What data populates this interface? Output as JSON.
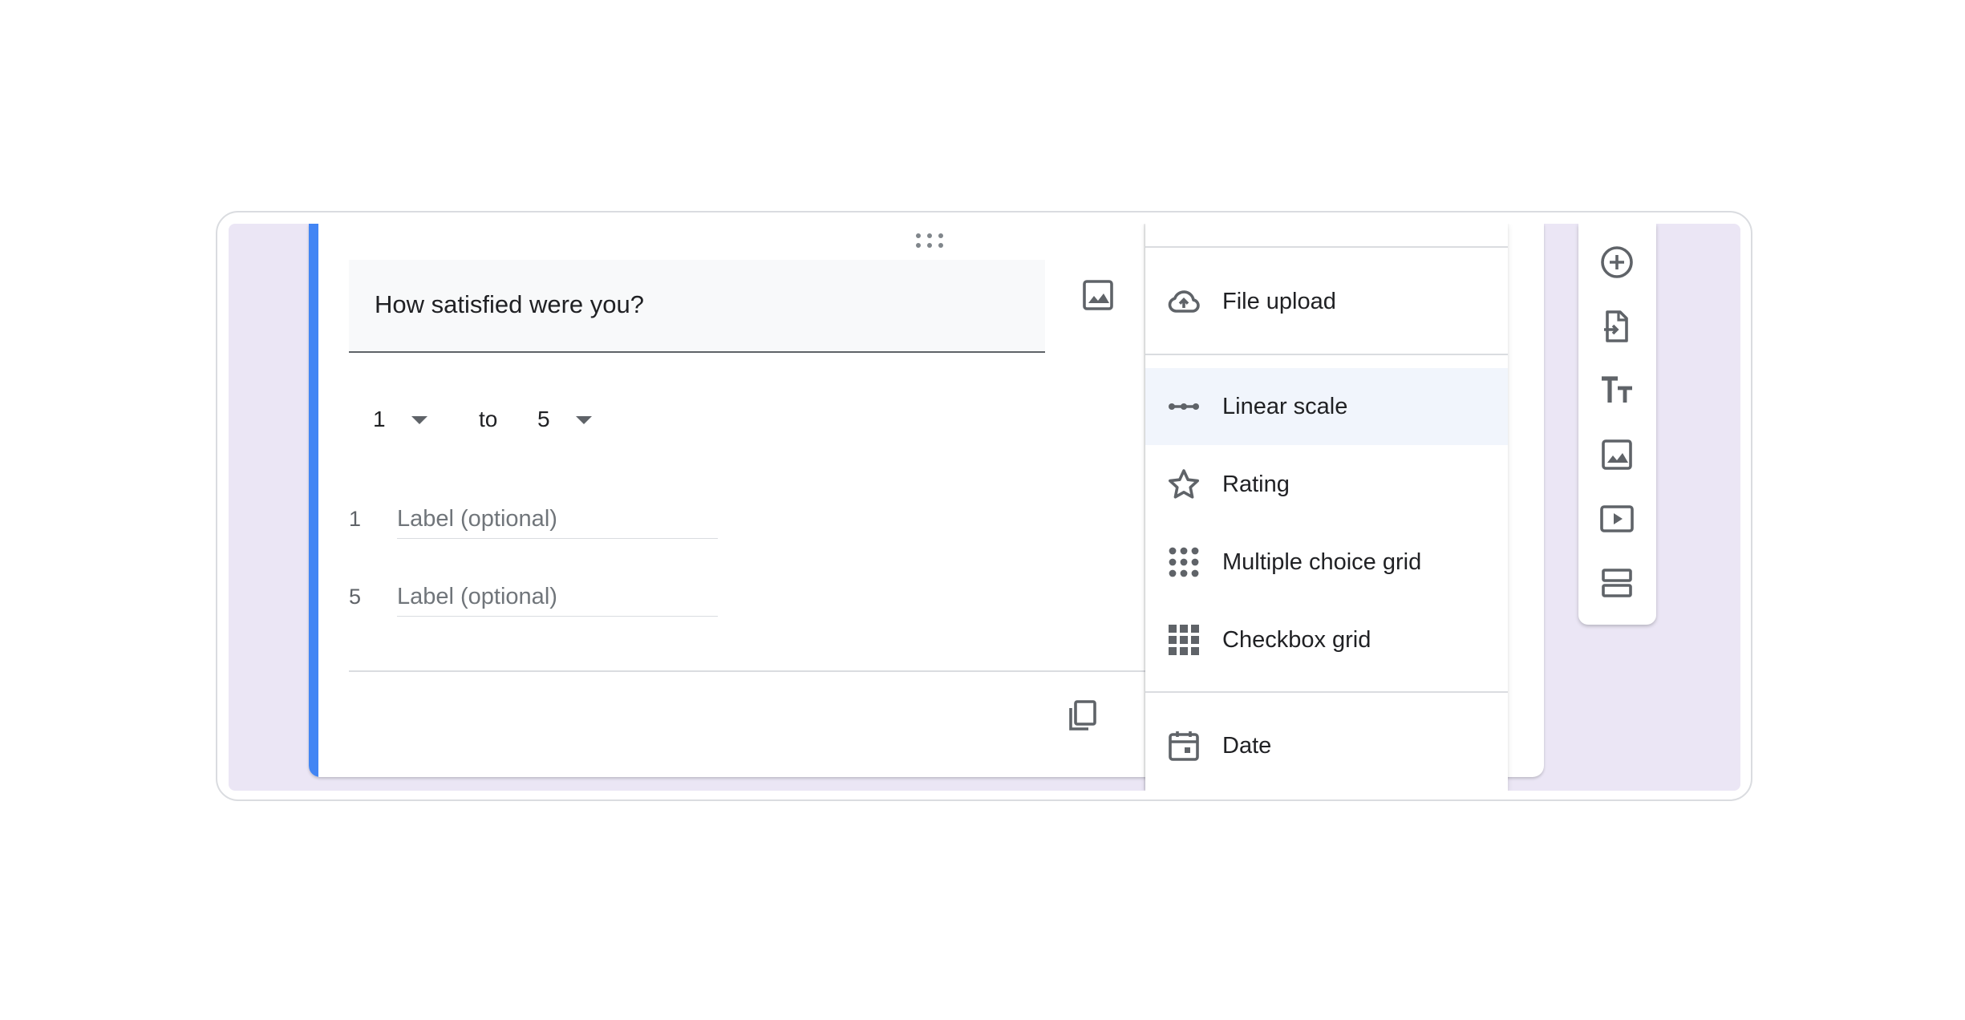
{
  "question": {
    "title": "How satisfied were you?",
    "scale_from": "1",
    "scale_to_word": "to",
    "scale_to": "5",
    "labels": [
      {
        "number": "1",
        "placeholder": "Label (optional)"
      },
      {
        "number": "5",
        "placeholder": "Label (optional)"
      }
    ]
  },
  "type_menu": {
    "items": [
      {
        "label": "File upload",
        "icon": "cloud-upload-icon"
      },
      {
        "label": "Linear scale",
        "icon": "linear-scale-icon",
        "selected": true
      },
      {
        "label": "Rating",
        "icon": "star-icon"
      },
      {
        "label": "Multiple choice grid",
        "icon": "dot-grid-icon"
      },
      {
        "label": "Checkbox grid",
        "icon": "square-grid-icon"
      },
      {
        "label": "Date",
        "icon": "calendar-icon"
      }
    ]
  },
  "toolbar": {
    "items": [
      "add-question-icon",
      "import-questions-icon",
      "title-text-icon",
      "add-image-icon",
      "add-video-icon",
      "add-section-icon"
    ]
  },
  "colors": {
    "accent": "#4285f4",
    "background": "#ebe6f5",
    "selected_item": "#f1f5fc",
    "icon": "#5f6368"
  }
}
